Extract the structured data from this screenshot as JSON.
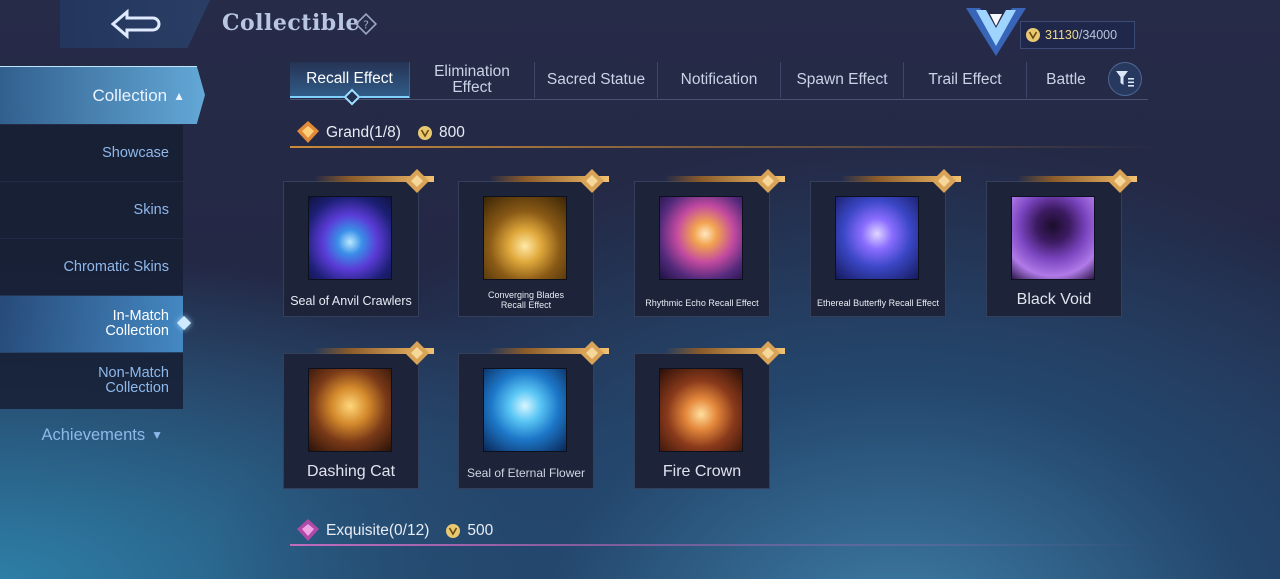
{
  "header": {
    "title": "Collectible",
    "currency_current": "31130",
    "currency_max": "/34000"
  },
  "sidebar": {
    "collection_label": "Collection",
    "items": [
      {
        "label": "Showcase"
      },
      {
        "label": "Skins"
      },
      {
        "label": "Chromatic Skins"
      },
      {
        "label": "In-Match Collection",
        "selected": true
      },
      {
        "label": "Non-Match Collection"
      }
    ],
    "achievements_label": "Achievements"
  },
  "tabs": [
    {
      "label": "Recall Effect",
      "active": true
    },
    {
      "label": "Elimination Effect"
    },
    {
      "label": "Sacred Statue"
    },
    {
      "label": "Notification"
    },
    {
      "label": "Spawn Effect"
    },
    {
      "label": "Trail Effect"
    },
    {
      "label": "Battle"
    }
  ],
  "grand": {
    "label": "Grand(1/8)",
    "cost": "800",
    "items": [
      {
        "name": "Seal of Anvil Crawlers"
      },
      {
        "name": "Converging Blades Recall Effect"
      },
      {
        "name": "Rhythmic Echo Recall Effect"
      },
      {
        "name": "Ethereal Butterfly Recall Effect"
      },
      {
        "name": "Black Void"
      },
      {
        "name": "Dashing Cat"
      },
      {
        "name": "Seal of Eternal Flower"
      },
      {
        "name": "Fire Crown"
      }
    ]
  },
  "exquisite": {
    "label": "Exquisite(0/12)",
    "cost": "500"
  },
  "colors": {
    "accent": "#7fd0ff",
    "gold": "#d9a458",
    "exquisite": "#c26bbd"
  }
}
